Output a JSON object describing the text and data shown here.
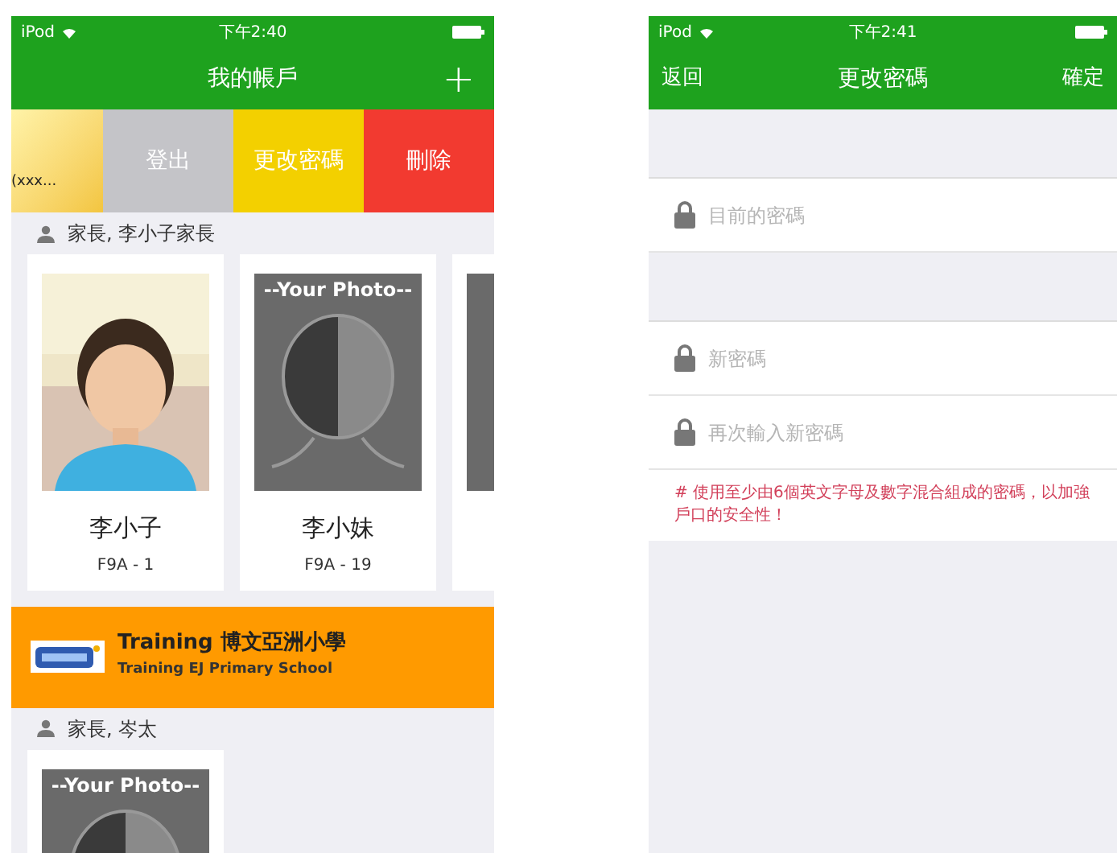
{
  "left_phone": {
    "status_bar": {
      "carrier": "iPod",
      "time": "下午2:40"
    },
    "nav_bar": {
      "title": "我的帳戶",
      "add": "+"
    },
    "swipe_row": {
      "cell_text": "(xxx...",
      "actions": [
        {
          "label": "登出",
          "color": "#c4c4c8"
        },
        {
          "label": "更改密碼",
          "color": "#f3d000"
        },
        {
          "label": "刪除",
          "color": "#f23a30"
        }
      ]
    },
    "sections": [
      {
        "kind": "parent",
        "header": "家長, 李小子家長",
        "students": [
          {
            "name": "李小子",
            "class": "F9A - 1"
          },
          {
            "kind": "placeholder",
            "photo_text": "--Your Photo--",
            "name": "李小妹",
            "class": "F9A - 19"
          },
          {
            "kind": "placeholder"
          }
        ]
      },
      {
        "kind": "school",
        "name": "Training 博文亞洲小學",
        "name_en": "Training EJ Primary School"
      },
      {
        "kind": "parent",
        "header": "家長, 岑太",
        "students": [
          {
            "kind": "placeholder",
            "photo_text": "--Your Photo--"
          }
        ]
      }
    ]
  },
  "right_phone": {
    "status_bar": {
      "carrier": "iPod",
      "time": "下午2:41"
    },
    "nav_bar": {
      "back": "返回",
      "title": "更改密碼",
      "confirm": "確定"
    },
    "field_groups": [
      [
        {
          "placeholder": "目前的密碼"
        }
      ],
      [
        {
          "placeholder": "新密碼"
        },
        {
          "placeholder": "再次輸入新密碼"
        }
      ]
    ],
    "hint": "# 使用至少由6個英文字母及數字混合組成的密碼，以加強戶口的安全性！"
  }
}
